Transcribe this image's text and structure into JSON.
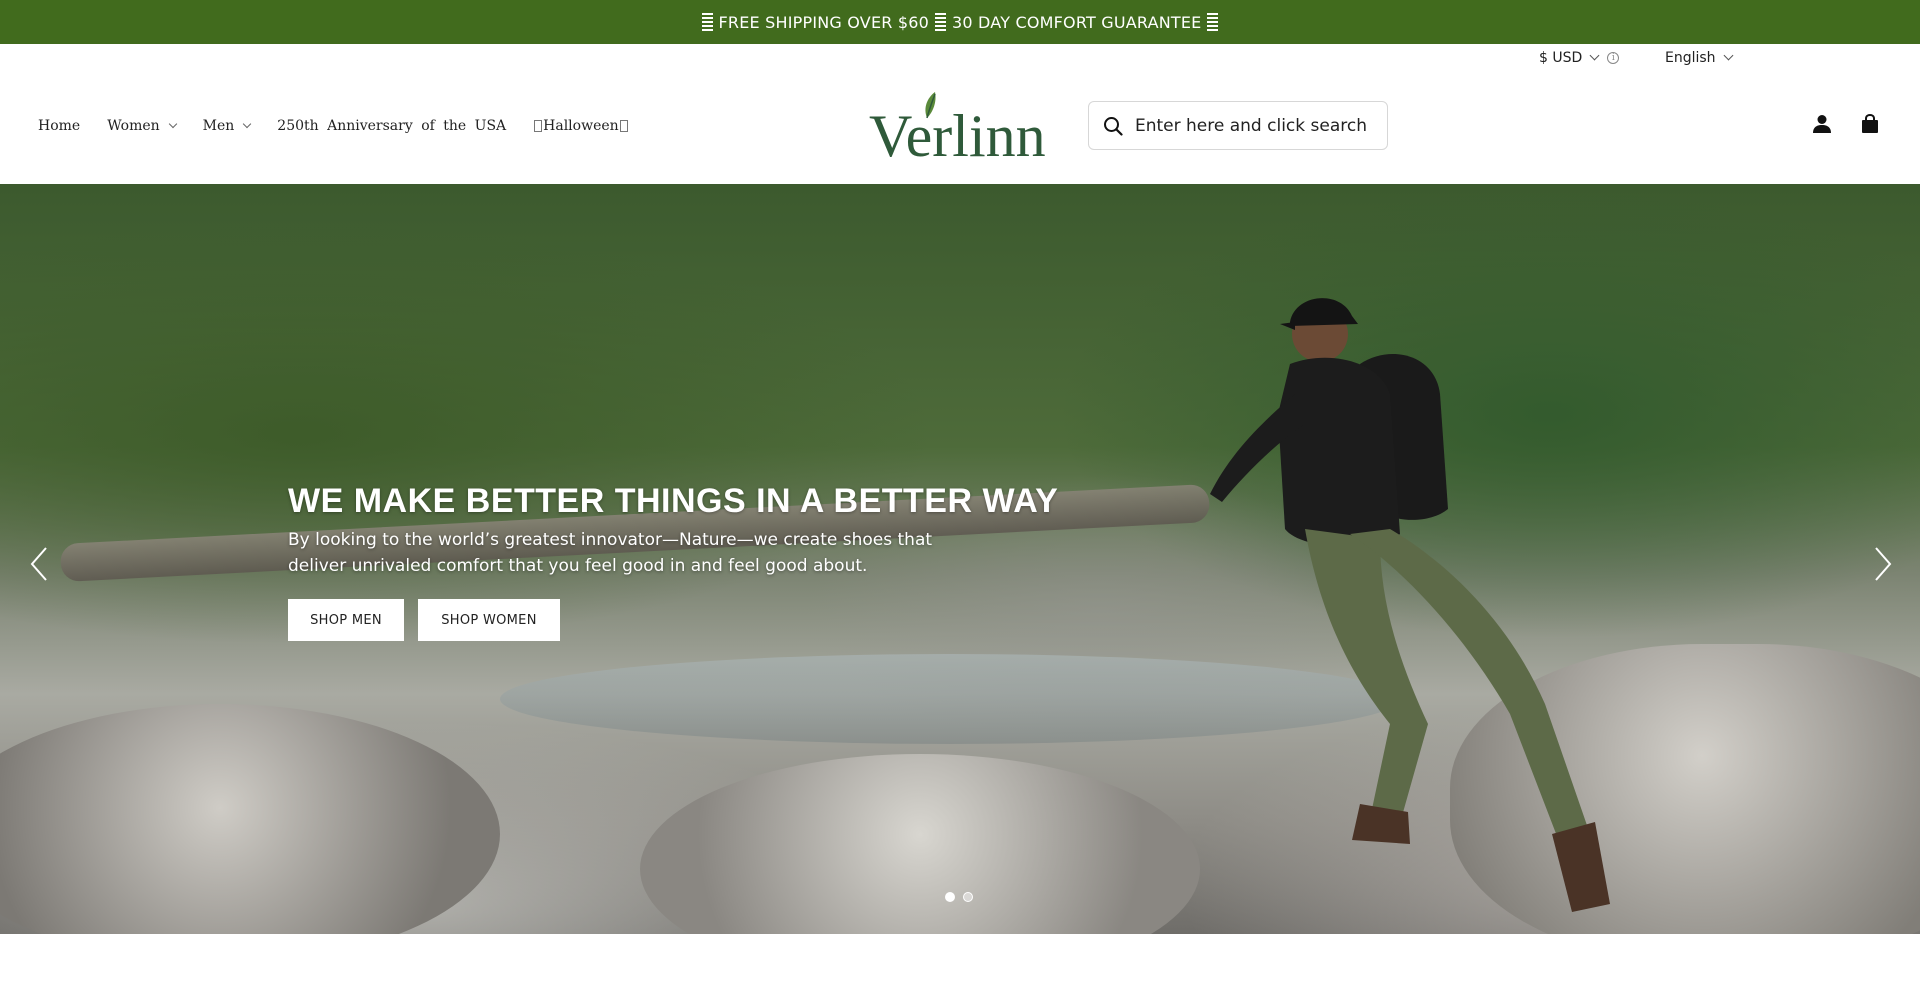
{
  "announcement": {
    "part1": "FREE SHIPPING OVER $60",
    "part2": "30 DAY COMFORT GUARANTEE"
  },
  "utility": {
    "currency": "$ USD",
    "info_glyph": "i",
    "language": "English"
  },
  "nav": {
    "items": [
      {
        "label": "Home",
        "has_dropdown": false
      },
      {
        "label": "Women",
        "has_dropdown": true
      },
      {
        "label": "Men",
        "has_dropdown": true
      },
      {
        "label": "250th Anniversary of the USA",
        "has_dropdown": false
      },
      {
        "label": "Halloween",
        "has_dropdown": false
      }
    ]
  },
  "brand": {
    "name": "Verlinn",
    "color": "#2f5a3a",
    "leaf_color": "#5a8a3a"
  },
  "search": {
    "placeholder": "Enter here and click search"
  },
  "icons": {
    "search": "search-icon",
    "account": "user-icon",
    "cart": "shopping-bag-icon",
    "prev": "chevron-left-icon",
    "next": "chevron-right-icon"
  },
  "hero": {
    "title": "WE MAKE BETTER THINGS IN A BETTER WAY",
    "subtitle": "By looking to the world’s greatest innovator—Nature—we create shoes that deliver unrivaled comfort that you feel good in and feel good about.",
    "buttons": {
      "men": "SHOP MEN",
      "women": "SHOP WOMEN"
    },
    "slides_total": 2,
    "active_slide": 1
  },
  "colors": {
    "announcement_bg": "#416b1d",
    "text": "#222222"
  }
}
